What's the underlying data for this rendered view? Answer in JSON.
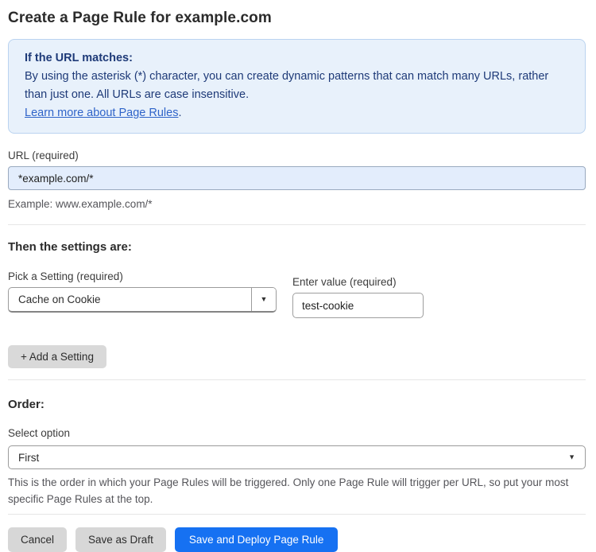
{
  "page": {
    "title": "Create a Page Rule for example.com"
  },
  "info_box": {
    "heading": "If the URL matches:",
    "body": "By using the asterisk (*) character, you can create dynamic patterns that can match many URLs, rather than just one. All URLs are case insensitive.",
    "link_label": "Learn more about Page Rules",
    "link_suffix": "."
  },
  "url_field": {
    "label": "URL (required)",
    "value": "*example.com/*",
    "helper": "Example: www.example.com/*"
  },
  "settings_section": {
    "heading": "Then the settings are:",
    "setting_label": "Pick a Setting (required)",
    "setting_value": "Cache on Cookie",
    "value_label": "Enter value (required)",
    "value_value": "test-cookie",
    "add_button_label": "+ Add a Setting"
  },
  "order_section": {
    "heading": "Order:",
    "select_label": "Select option",
    "select_value": "First",
    "helper": "This is the order in which your Page Rules will be triggered. Only one Page Rule will trigger per URL, so put your most specific Page Rules at the top."
  },
  "actions": {
    "cancel_label": "Cancel",
    "save_draft_label": "Save as Draft",
    "save_deploy_label": "Save and Deploy Page Rule"
  },
  "icons": {
    "caret": "▼"
  },
  "colors": {
    "info_box_bg": "#e8f1fb",
    "info_box_border": "#bad3f0",
    "info_text": "#1e3a78",
    "link_blue": "#2f64c9",
    "url_input_bg": "#e3edfc",
    "primary_button_blue": "#1671f2",
    "gray_button": "#d7d7d7"
  }
}
